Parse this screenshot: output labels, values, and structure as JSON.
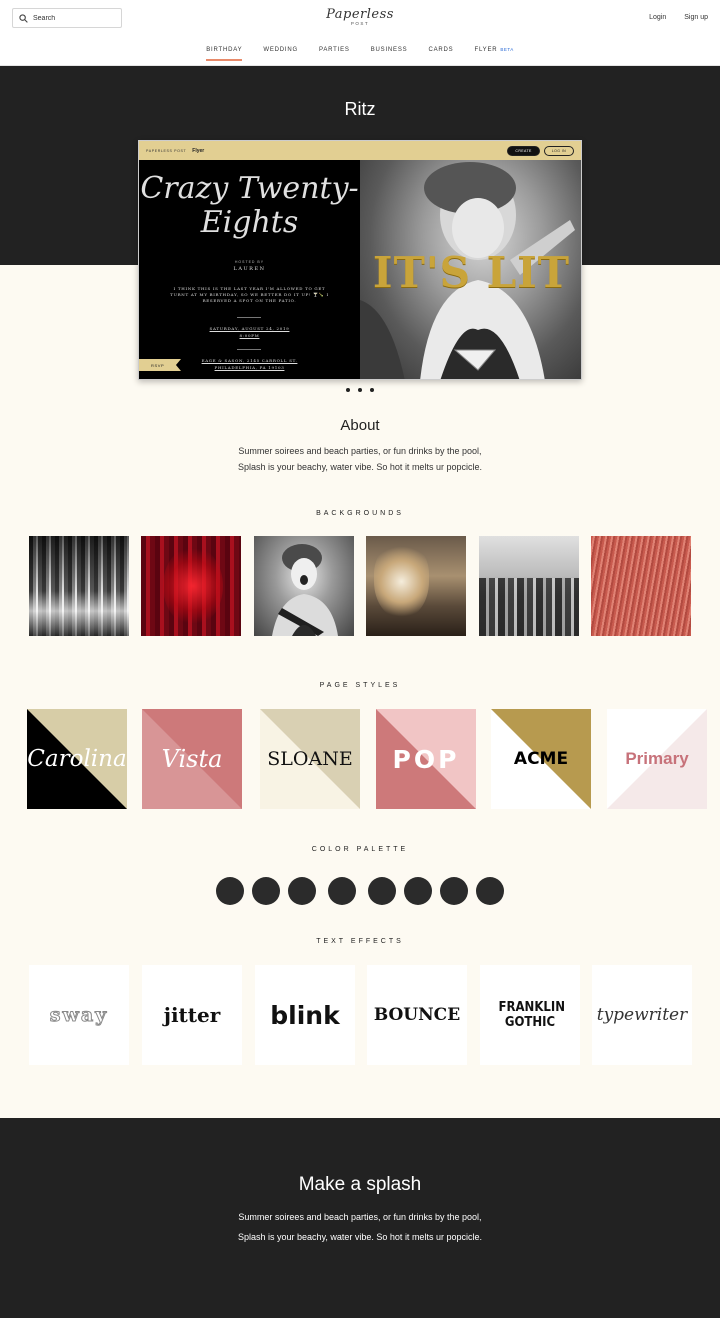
{
  "header": {
    "search_placeholder": "Search",
    "logo": "Paperless",
    "logo_sub": "POST",
    "login": "Login",
    "signup": "Sign up"
  },
  "nav": {
    "tabs": [
      {
        "label": "BIRTHDAY",
        "active": true
      },
      {
        "label": "WEDDING"
      },
      {
        "label": "PARTIES"
      },
      {
        "label": "BUSINESS"
      },
      {
        "label": "CARDS"
      },
      {
        "label": "FLYER",
        "badge": "BETA"
      }
    ]
  },
  "hero": {
    "title": "Ritz"
  },
  "preview": {
    "brand": "PAPERLESS POST",
    "product": "Flyer",
    "create": "CREATE",
    "login": "LOG IN",
    "headline": "Crazy Twenty-Eights",
    "hosted_by": "HOSTED BY",
    "host": "LAUREN",
    "message": "I THINK THIS IS THE LAST YEAR I'M ALLOWED TO GET TURNT AT MY BIRTHDAY, SO WE BETTER DO IT UP! 🍸🍾 I RESERVED A SPOT ON THE PATIO.",
    "date": "SATURDAY, AUGUST 24, 2019",
    "time": "8:00PM",
    "venue": "EAGE & SASON, 2145 CARROLL ST.",
    "city": "PHILADELPHIA, PA 19103",
    "rsvp": "RSVP",
    "photo_text": "IT'S LIT"
  },
  "about": {
    "title": "About",
    "line1": "Summer soirees and beach parties, or fun drinks by the pool,",
    "line2": "Splash is your beachy, water vibe. So hot it melts ur popcicle."
  },
  "sections": {
    "backgrounds": "BACKGROUNDS",
    "page_styles": "PAGE STYLES",
    "color_palette": "COLOR PALETTE",
    "text_effects": "TEXT EFFECTS"
  },
  "page_styles": [
    "Carolina",
    "Vista",
    "SLOANE",
    "POP",
    "ACME",
    "Primary"
  ],
  "color_palette": [
    "#2b2b2b",
    "#2b2b2b",
    "#2b2b2b",
    "#2b2b2b",
    "#2b2b2b",
    "#2b2b2b",
    "#2b2b2b",
    "#2b2b2b"
  ],
  "text_effects": [
    "sway",
    "jitter",
    "blink",
    "BOUNCE",
    "FRANKLIN GOTHIC",
    "typewriter"
  ],
  "footer": {
    "title": "Make a splash",
    "line1": "Summer soirees and beach parties, or fun drinks by the pool,",
    "line2": "Splash is your beachy, water vibe. So hot it melts ur popcicle."
  }
}
